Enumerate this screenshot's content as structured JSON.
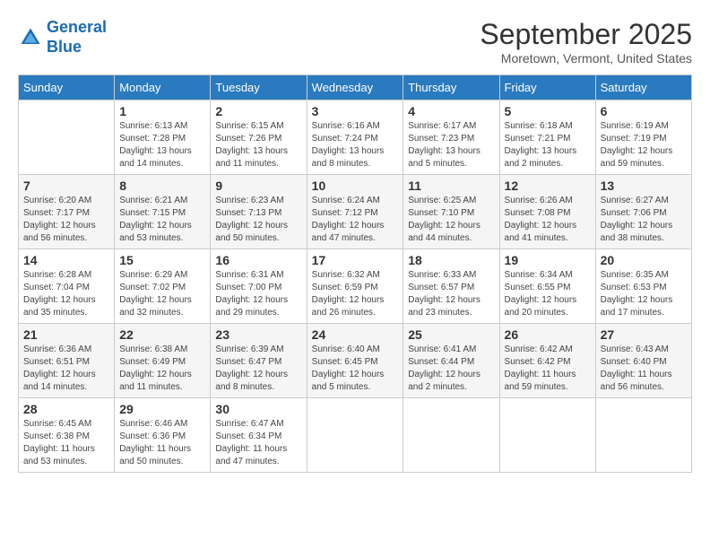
{
  "logo": {
    "line1": "General",
    "line2": "Blue"
  },
  "title": "September 2025",
  "subtitle": "Moretown, Vermont, United States",
  "days_of_week": [
    "Sunday",
    "Monday",
    "Tuesday",
    "Wednesday",
    "Thursday",
    "Friday",
    "Saturday"
  ],
  "weeks": [
    [
      {
        "day": "",
        "info": ""
      },
      {
        "day": "1",
        "info": "Sunrise: 6:13 AM\nSunset: 7:28 PM\nDaylight: 13 hours\nand 14 minutes."
      },
      {
        "day": "2",
        "info": "Sunrise: 6:15 AM\nSunset: 7:26 PM\nDaylight: 13 hours\nand 11 minutes."
      },
      {
        "day": "3",
        "info": "Sunrise: 6:16 AM\nSunset: 7:24 PM\nDaylight: 13 hours\nand 8 minutes."
      },
      {
        "day": "4",
        "info": "Sunrise: 6:17 AM\nSunset: 7:23 PM\nDaylight: 13 hours\nand 5 minutes."
      },
      {
        "day": "5",
        "info": "Sunrise: 6:18 AM\nSunset: 7:21 PM\nDaylight: 13 hours\nand 2 minutes."
      },
      {
        "day": "6",
        "info": "Sunrise: 6:19 AM\nSunset: 7:19 PM\nDaylight: 12 hours\nand 59 minutes."
      }
    ],
    [
      {
        "day": "7",
        "info": "Sunrise: 6:20 AM\nSunset: 7:17 PM\nDaylight: 12 hours\nand 56 minutes."
      },
      {
        "day": "8",
        "info": "Sunrise: 6:21 AM\nSunset: 7:15 PM\nDaylight: 12 hours\nand 53 minutes."
      },
      {
        "day": "9",
        "info": "Sunrise: 6:23 AM\nSunset: 7:13 PM\nDaylight: 12 hours\nand 50 minutes."
      },
      {
        "day": "10",
        "info": "Sunrise: 6:24 AM\nSunset: 7:12 PM\nDaylight: 12 hours\nand 47 minutes."
      },
      {
        "day": "11",
        "info": "Sunrise: 6:25 AM\nSunset: 7:10 PM\nDaylight: 12 hours\nand 44 minutes."
      },
      {
        "day": "12",
        "info": "Sunrise: 6:26 AM\nSunset: 7:08 PM\nDaylight: 12 hours\nand 41 minutes."
      },
      {
        "day": "13",
        "info": "Sunrise: 6:27 AM\nSunset: 7:06 PM\nDaylight: 12 hours\nand 38 minutes."
      }
    ],
    [
      {
        "day": "14",
        "info": "Sunrise: 6:28 AM\nSunset: 7:04 PM\nDaylight: 12 hours\nand 35 minutes."
      },
      {
        "day": "15",
        "info": "Sunrise: 6:29 AM\nSunset: 7:02 PM\nDaylight: 12 hours\nand 32 minutes."
      },
      {
        "day": "16",
        "info": "Sunrise: 6:31 AM\nSunset: 7:00 PM\nDaylight: 12 hours\nand 29 minutes."
      },
      {
        "day": "17",
        "info": "Sunrise: 6:32 AM\nSunset: 6:59 PM\nDaylight: 12 hours\nand 26 minutes."
      },
      {
        "day": "18",
        "info": "Sunrise: 6:33 AM\nSunset: 6:57 PM\nDaylight: 12 hours\nand 23 minutes."
      },
      {
        "day": "19",
        "info": "Sunrise: 6:34 AM\nSunset: 6:55 PM\nDaylight: 12 hours\nand 20 minutes."
      },
      {
        "day": "20",
        "info": "Sunrise: 6:35 AM\nSunset: 6:53 PM\nDaylight: 12 hours\nand 17 minutes."
      }
    ],
    [
      {
        "day": "21",
        "info": "Sunrise: 6:36 AM\nSunset: 6:51 PM\nDaylight: 12 hours\nand 14 minutes."
      },
      {
        "day": "22",
        "info": "Sunrise: 6:38 AM\nSunset: 6:49 PM\nDaylight: 12 hours\nand 11 minutes."
      },
      {
        "day": "23",
        "info": "Sunrise: 6:39 AM\nSunset: 6:47 PM\nDaylight: 12 hours\nand 8 minutes."
      },
      {
        "day": "24",
        "info": "Sunrise: 6:40 AM\nSunset: 6:45 PM\nDaylight: 12 hours\nand 5 minutes."
      },
      {
        "day": "25",
        "info": "Sunrise: 6:41 AM\nSunset: 6:44 PM\nDaylight: 12 hours\nand 2 minutes."
      },
      {
        "day": "26",
        "info": "Sunrise: 6:42 AM\nSunset: 6:42 PM\nDaylight: 11 hours\nand 59 minutes."
      },
      {
        "day": "27",
        "info": "Sunrise: 6:43 AM\nSunset: 6:40 PM\nDaylight: 11 hours\nand 56 minutes."
      }
    ],
    [
      {
        "day": "28",
        "info": "Sunrise: 6:45 AM\nSunset: 6:38 PM\nDaylight: 11 hours\nand 53 minutes."
      },
      {
        "day": "29",
        "info": "Sunrise: 6:46 AM\nSunset: 6:36 PM\nDaylight: 11 hours\nand 50 minutes."
      },
      {
        "day": "30",
        "info": "Sunrise: 6:47 AM\nSunset: 6:34 PM\nDaylight: 11 hours\nand 47 minutes."
      },
      {
        "day": "",
        "info": ""
      },
      {
        "day": "",
        "info": ""
      },
      {
        "day": "",
        "info": ""
      },
      {
        "day": "",
        "info": ""
      }
    ]
  ]
}
